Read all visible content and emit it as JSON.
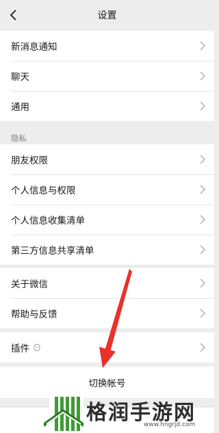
{
  "header": {
    "title": "设置",
    "back_icon": "chevron-left-icon"
  },
  "groups": [
    {
      "items": [
        {
          "label": "新消息通知"
        },
        {
          "label": "聊天"
        },
        {
          "label": "通用"
        }
      ]
    },
    {
      "section_title": "隐私",
      "items": [
        {
          "label": "朋友权限"
        },
        {
          "label": "个人信息与权限"
        },
        {
          "label": "个人信息收集清单"
        },
        {
          "label": "第三方信息共享清单"
        }
      ]
    },
    {
      "items": [
        {
          "label": "关于微信"
        },
        {
          "label": "帮助与反馈"
        }
      ]
    },
    {
      "items": [
        {
          "label": "插件",
          "icon": "plugin-icon"
        }
      ]
    }
  ],
  "switch_account": {
    "label": "切换帐号"
  },
  "annotation": {
    "color": "#e8322b",
    "icon": "red-arrow"
  },
  "watermark": {
    "name": "格润手游网",
    "url": "www.hngrjd.com",
    "brand_color": "#3d9b35"
  }
}
